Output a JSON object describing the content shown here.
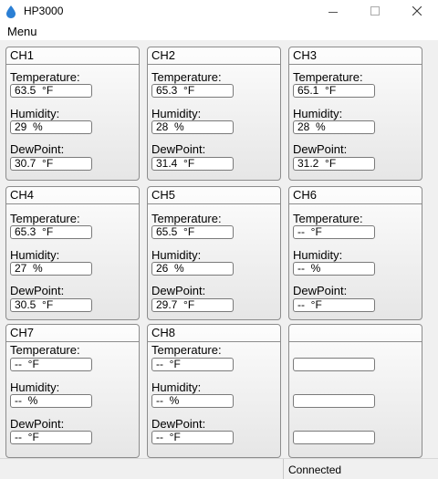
{
  "window": {
    "title": "HP3000",
    "icon": "water-drop-icon"
  },
  "menu": {
    "label": "Menu"
  },
  "channels": [
    {
      "name": "CH1",
      "temperature": "63.5  °F",
      "humidity": "29  %",
      "dewpoint": "30.7  °F"
    },
    {
      "name": "CH2",
      "temperature": "65.3  °F",
      "humidity": "28  %",
      "dewpoint": "31.4  °F"
    },
    {
      "name": "CH3",
      "temperature": "65.1  °F",
      "humidity": "28  %",
      "dewpoint": "31.2  °F"
    },
    {
      "name": "CH4",
      "temperature": "65.3  °F",
      "humidity": "27  %",
      "dewpoint": "30.5  °F"
    },
    {
      "name": "CH5",
      "temperature": "65.5  °F",
      "humidity": "26  %",
      "dewpoint": "29.7  °F"
    },
    {
      "name": "CH6",
      "temperature": "--  °F",
      "humidity": "--  %",
      "dewpoint": "--  °F"
    },
    {
      "name": "CH7",
      "temperature": "--  °F",
      "humidity": "--  %",
      "dewpoint": "--  °F"
    },
    {
      "name": "CH8",
      "temperature": "--  °F",
      "humidity": "--  %",
      "dewpoint": "--  °F"
    },
    {
      "name": "",
      "temperature": "",
      "humidity": "",
      "dewpoint": ""
    }
  ],
  "labels": {
    "temperature": "Temperature:",
    "humidity": "Humidity:",
    "dewpoint": "DewPoint:"
  },
  "status": {
    "text": "Connected"
  },
  "colors": {
    "icon_blue": "#2b7fd4"
  }
}
